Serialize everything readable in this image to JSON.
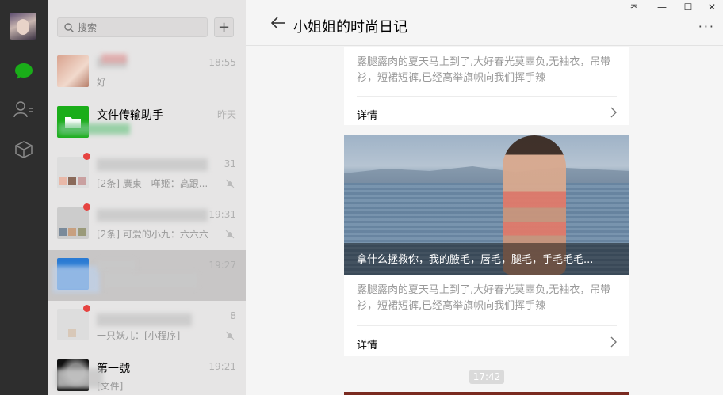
{
  "window": {
    "pin": "ᅎ",
    "minimize": "—",
    "maximize": "☐",
    "close": "✕"
  },
  "nav": {
    "items": [
      "avatar",
      "chat-icon",
      "contacts-icon",
      "mini-programs-icon"
    ]
  },
  "search": {
    "placeholder": "搜索",
    "add_label": "+"
  },
  "chats": [
    {
      "name": "",
      "msg": "好",
      "time": "18:55"
    },
    {
      "name": "文件传输助手",
      "msg": "",
      "time": "昨天"
    },
    {
      "name": "",
      "msg": "[2条] 廣東 - 咩姬：高跟...",
      "time": "31"
    },
    {
      "name": "",
      "msg": "[2条] 可爱的小九：六六六",
      "time": "19:31"
    },
    {
      "name": "",
      "msg": "",
      "time": "19:27"
    },
    {
      "name": "",
      "msg": "一只妖儿：[小程序]",
      "time": "8"
    },
    {
      "name": "第一號",
      "msg": "[文件]",
      "time": "19:21"
    }
  ],
  "conversation": {
    "title": "小姐姐的时尚日记",
    "more": "···",
    "card1": {
      "desc": "露腿露肉的夏天马上到了,大好春光莫辜负,无袖衣，吊带衫，短裙短裤,已经高举旗帜向我们挥手辣",
      "detail": "详情"
    },
    "photo_caption": "拿什么拯救你，我的腋毛，唇毛，腿毛，手毛毛毛...",
    "card2": {
      "desc": "露腿露肉的夏天马上到了,大好春光莫辜负,无袖衣，吊带衫，短裙短裤,已经高举旗帜向我们挥手辣",
      "detail": "详情"
    },
    "timestamp": "17:42"
  },
  "colors": {
    "accent_green": "#1aad19",
    "nav_bg": "#2e2e2e",
    "badge_red": "#e64340"
  }
}
